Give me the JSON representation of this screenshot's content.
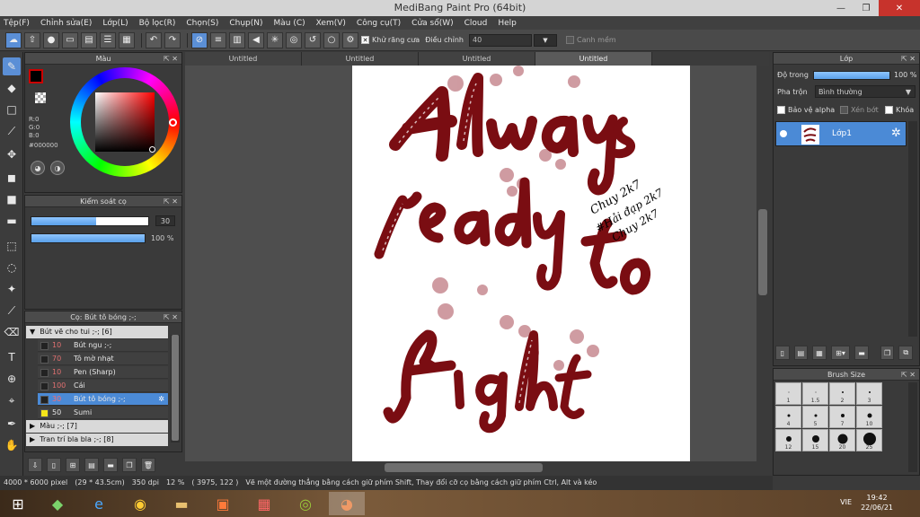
{
  "window": {
    "title": "MediBang Paint Pro (64bit)",
    "min": "—",
    "max": "❐",
    "close": "✕"
  },
  "menu": [
    "Tệp(F)",
    "Chỉnh sửa(E)",
    "Lớp(L)",
    "Bộ lọc(R)",
    "Chọn(S)",
    "Chụp(N)",
    "Màu (C)",
    "Xem(V)",
    "Công cụ(T)",
    "Cửa sổ(W)",
    "Cloud",
    "Help"
  ],
  "toolbar": {
    "antialias_label": "Khử răng cưa",
    "correction_label": "Điều chỉnh",
    "correction_value": "40",
    "edge_label": "Canh mềm"
  },
  "color_panel": {
    "title": "Màu",
    "r": "R:0",
    "g": "G:0",
    "b": "B:0",
    "hex": "#000000",
    "fg": "#000000"
  },
  "brush_control": {
    "title": "Kiểm soát cọ",
    "size": "30",
    "opacity": "100 %",
    "size_fraction": 0.55,
    "opacity_fraction": 1.0
  },
  "brush_list": {
    "title": "Cọ: Bút tô bóng ;-;",
    "groups": [
      "Bút vẽ cho tui ;-; [6]",
      "Màu ;-; [7]",
      "Tran trí bla bla ;-; [8]"
    ],
    "items": [
      {
        "n": "10",
        "label": "Bút ngu ;-;"
      },
      {
        "n": "70",
        "label": "Tô mờ nhạt"
      },
      {
        "n": "10",
        "label": "Pen (Sharp)"
      },
      {
        "n": "100",
        "label": "Cái"
      },
      {
        "n": "30",
        "label": "Bút tô bóng ;-;"
      },
      {
        "n": "50",
        "label": "Sumi"
      }
    ]
  },
  "tabs": [
    "Untitled",
    "Untitled",
    "Untitled",
    "Untitled"
  ],
  "status": {
    "size": "4000 * 6000 pixel",
    "cm": "(29 * 43.5cm)",
    "dpi": "350 dpi",
    "zoom": "12 %",
    "coord": "( 3975, 122 )",
    "hint": "Vẽ một đường thẳng bằng cách giữ phím Shift, Thay đổi cỡ cọ bằng cách giữ phím Ctrl, Alt và kéo"
  },
  "layer_panel": {
    "title": "Lớp",
    "opacity_label": "Độ trong",
    "opacity_value": "100 %",
    "blend_label": "Pha trộn",
    "blend_value": "Bình thường",
    "protect_alpha": "Bảo vệ alpha",
    "clip": "Xén bớt",
    "lock": "Khóa",
    "layer_name": "Lớp1"
  },
  "brush_size": {
    "title": "Brush Size",
    "sizes": [
      "1",
      "1.5",
      "2",
      "3",
      "4",
      "5",
      "7",
      "10",
      "12",
      "15",
      "20",
      "25"
    ]
  },
  "taskbar": {
    "lang": "VIE",
    "time": "19:42",
    "date": "22/06/21"
  },
  "artwork": {
    "line1": "Always",
    "line2": "ready",
    "line3": "to",
    "line4": "fight",
    "signature1": "Chuy 2k7",
    "signature2": "#Hải đạp 2k7",
    "signature3": "Chuy 2k7",
    "ink": "#7a0d12"
  }
}
